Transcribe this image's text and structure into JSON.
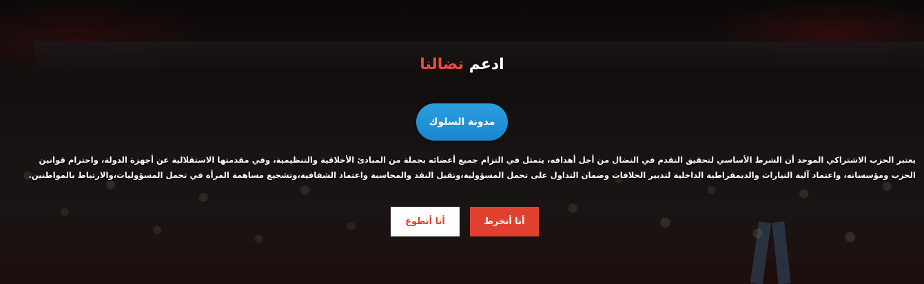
{
  "section": {
    "title_main": "ادعم ",
    "title_accent": "نضالنا",
    "code_button_label": "مدونة السلوك",
    "description": "يعتبر الحزب الاشتراكي الموحد أن الشرط الأساسي لتحقيق التقدم في النضال من أجل أهدافه، يتمثل في التزام جميع أعضائه بجملة من المبادئ الأخلاقية والتنظيمية، وفي مقدمتها الاستقلالية عن أجهزة الدولة، واحترام قوانين الحزب ومؤسساته، واعتماد آلية التيارات والديمقراطية الداخلية لتدبير الخلافات وضمان التداول على تحمل المسؤولية،وتقبل النقد والمحاسبة واعتماد الشفافية،وتشجيع مساهمة المرأة في تحمل المسؤوليات،والارتباط بالمواطنين.",
    "join_button_label": "أنا أنخرط",
    "volunteer_button_label": "أنا أتطوع"
  },
  "colors": {
    "accent_red": "#e0412f",
    "title_accent": "#f04a3a",
    "button_blue": "#1a87cf"
  }
}
